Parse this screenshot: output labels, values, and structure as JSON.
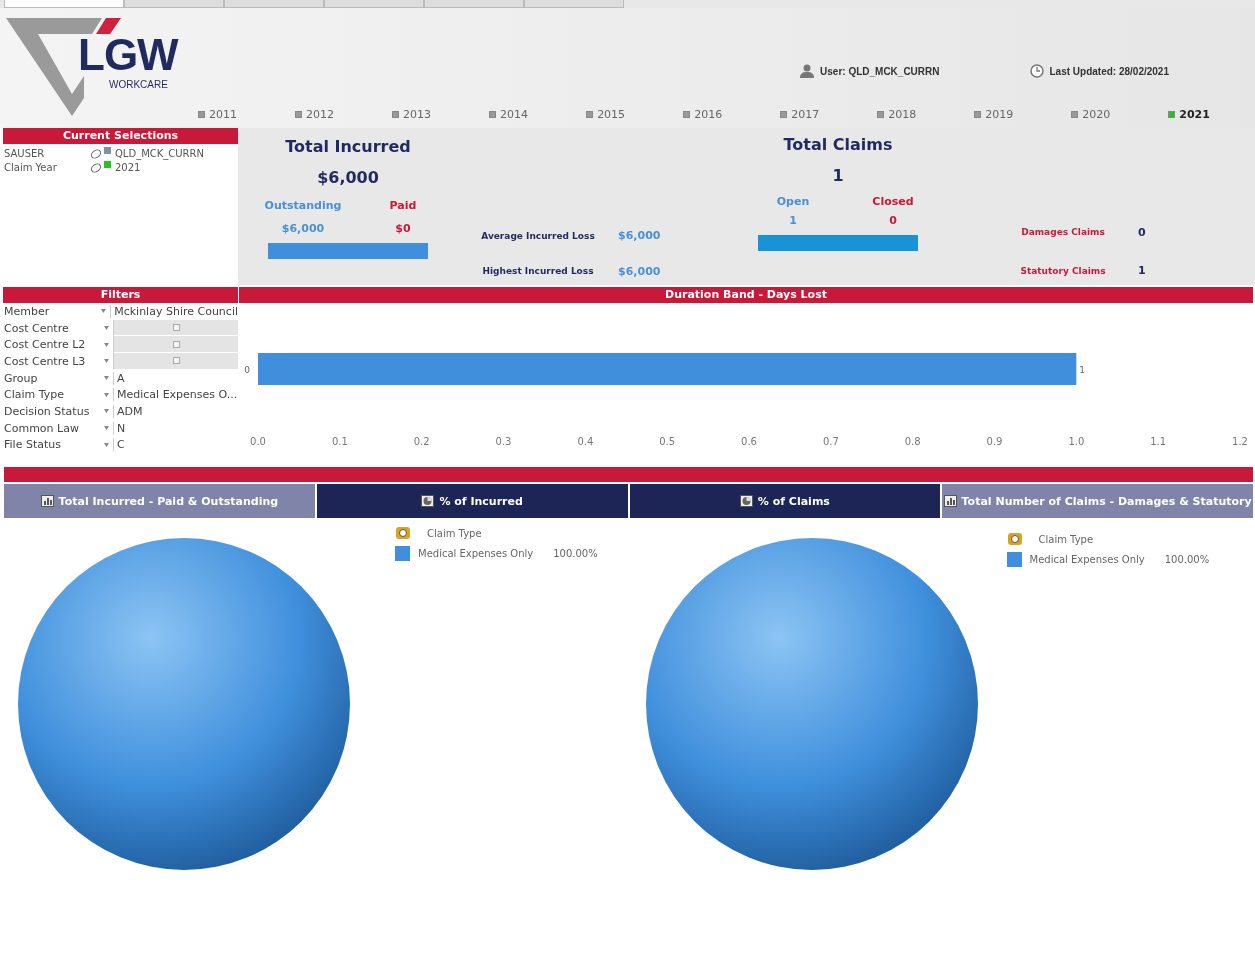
{
  "tabs": [
    {
      "selected": true
    },
    {
      "selected": false
    },
    {
      "selected": false
    },
    {
      "selected": false
    },
    {
      "selected": false
    },
    {
      "selected": false
    }
  ],
  "logo": {
    "name": "LGW",
    "subtitle": "WORKCARE"
  },
  "user": "User: QLD_MCK_CURRN",
  "last_updated": "Last Updated: 28/02/2021",
  "years": [
    {
      "label": "2011",
      "selected": false
    },
    {
      "label": "2012",
      "selected": false
    },
    {
      "label": "2013",
      "selected": false
    },
    {
      "label": "2014",
      "selected": false
    },
    {
      "label": "2015",
      "selected": false
    },
    {
      "label": "2016",
      "selected": false
    },
    {
      "label": "2017",
      "selected": false
    },
    {
      "label": "2018",
      "selected": false
    },
    {
      "label": "2019",
      "selected": false
    },
    {
      "label": "2020",
      "selected": false
    },
    {
      "label": "2021",
      "selected": true
    }
  ],
  "current_selections": {
    "title": "Current Selections",
    "items": [
      {
        "field": "SAUSER",
        "value": "QLD_MCK_CURRN",
        "color": "#7f8fa6"
      },
      {
        "field": "Claim Year",
        "value": "2021",
        "color": "#22c422"
      }
    ]
  },
  "total_incurred": {
    "title": "Total Incurred",
    "value": "$6,000",
    "outstanding_label": "Outstanding",
    "paid_label": "Paid",
    "outstanding": "$6,000",
    "paid": "$0"
  },
  "losses": [
    {
      "label": "Average Incurred Loss",
      "value": "$6,000"
    },
    {
      "label": "Highest Incurred Loss",
      "value": "$6,000"
    }
  ],
  "total_claims": {
    "title": "Total Claims",
    "value": "1",
    "open_label": "Open",
    "closed_label": "Closed",
    "open": "1",
    "closed": "0"
  },
  "claim_types": [
    {
      "label": "Damages Claims",
      "value": "0"
    },
    {
      "label": "Statutory Claims",
      "value": "1"
    }
  ],
  "filters": {
    "title": "Filters",
    "items": [
      {
        "field": "Member",
        "value": "Mckinlay Shire Council"
      },
      {
        "field": "Cost Centre"
      },
      {
        "field": "Cost Centre L2"
      },
      {
        "field": "Cost Centre L3"
      },
      {
        "field": "Group",
        "value": "A"
      },
      {
        "field": "Claim Type",
        "value": "Medical Expenses O..."
      },
      {
        "field": "Decision Status",
        "value": "ADM"
      },
      {
        "field": "Common Law",
        "value": "N"
      },
      {
        "field": "File Status",
        "value": "C"
      }
    ]
  },
  "duration": {
    "title": "Duration Band - Days Lost",
    "chart_data": {
      "type": "bar",
      "orientation": "horizontal",
      "categories": [
        "0"
      ],
      "series": [
        {
          "color": "#3f8fdc",
          "values": [
            1
          ]
        }
      ],
      "xlim": [
        0,
        1.2
      ],
      "xticks": [
        {
          "value": 0,
          "label": "0.0"
        },
        {
          "value": 0.1,
          "label": "0.1"
        },
        {
          "value": 0.2,
          "label": "0.2"
        },
        {
          "value": 0.3,
          "label": "0.3"
        },
        {
          "value": 0.4,
          "label": "0.4"
        },
        {
          "value": 0.5,
          "label": "0.5"
        },
        {
          "value": 0.6,
          "label": "0.6"
        },
        {
          "value": 0.7,
          "label": "0.7"
        },
        {
          "value": 0.8,
          "label": "0.8"
        },
        {
          "value": 0.9,
          "label": "0.9"
        },
        {
          "value": 1,
          "label": "1.0"
        },
        {
          "value": 1.1,
          "label": "1.1"
        },
        {
          "value": 1.2,
          "label": "1.2"
        }
      ],
      "data_labels": true
    }
  },
  "chart_tabs": [
    {
      "label": "Total Incurred - Paid & Outstanding",
      "kind": "bar"
    },
    {
      "label": "% of Incurred",
      "kind": "pie"
    },
    {
      "label": "% of Claims",
      "kind": "pie"
    },
    {
      "label": "Total Number of Claims - Damages & Statutory",
      "kind": "bar"
    }
  ],
  "pies": [
    {
      "legend_title": "Claim Type",
      "chart_data": {
        "type": "pie",
        "categories": [
          "Medical Expenses Only"
        ],
        "series": [
          {
            "color": "#3f8fdc",
            "values": [
              100
            ]
          }
        ],
        "value_labels": [
          "100.00%"
        ]
      }
    },
    {
      "legend_title": "Claim Type",
      "chart_data": {
        "type": "pie",
        "categories": [
          "Medical Expenses Only"
        ],
        "series": [
          {
            "color": "#3f8fdc",
            "values": [
              100
            ]
          }
        ],
        "value_labels": [
          "100.00%"
        ]
      }
    }
  ]
}
